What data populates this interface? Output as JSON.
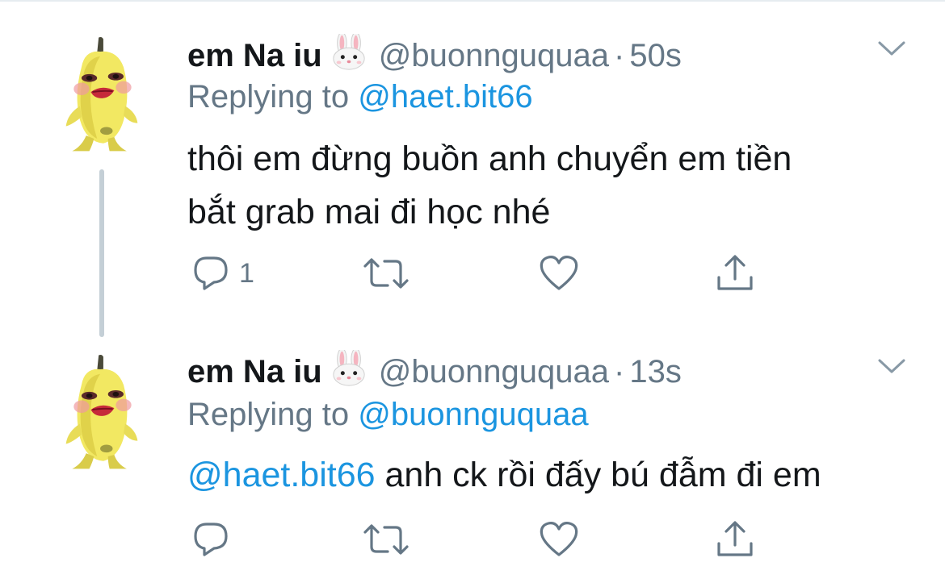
{
  "tweets": [
    {
      "display_name": "em Na iu",
      "name_emoji": "rabbit-face",
      "handle": "@buonnguquaa",
      "separator": "·",
      "time": "50s",
      "replying_prefix": "Replying to",
      "replying_to": "@haet.bit66",
      "text_mention": "",
      "text_line1": "thôi em đừng buồn anh chuyển em tiền",
      "text_line2": "bắt grab mai đi học nhé",
      "reply_count": "1",
      "retweet_count": "",
      "like_count": ""
    },
    {
      "display_name": "em Na iu",
      "name_emoji": "rabbit-face",
      "handle": "@buonnguquaa",
      "separator": "·",
      "time": "13s",
      "replying_prefix": "Replying to",
      "replying_to": "@buonnguquaa",
      "text_mention": "@haet.bit66",
      "text_body": " anh ck rồi đấy bú đẫm đi em",
      "reply_count": "",
      "retweet_count": "",
      "like_count": ""
    }
  ],
  "colors": {
    "text": "#14171a",
    "secondary": "#657786",
    "link": "#1b95e0",
    "thread_line": "#c4cfd6"
  },
  "icons": [
    "reply-icon",
    "retweet-icon",
    "like-icon",
    "share-icon",
    "chevron-down-icon"
  ]
}
